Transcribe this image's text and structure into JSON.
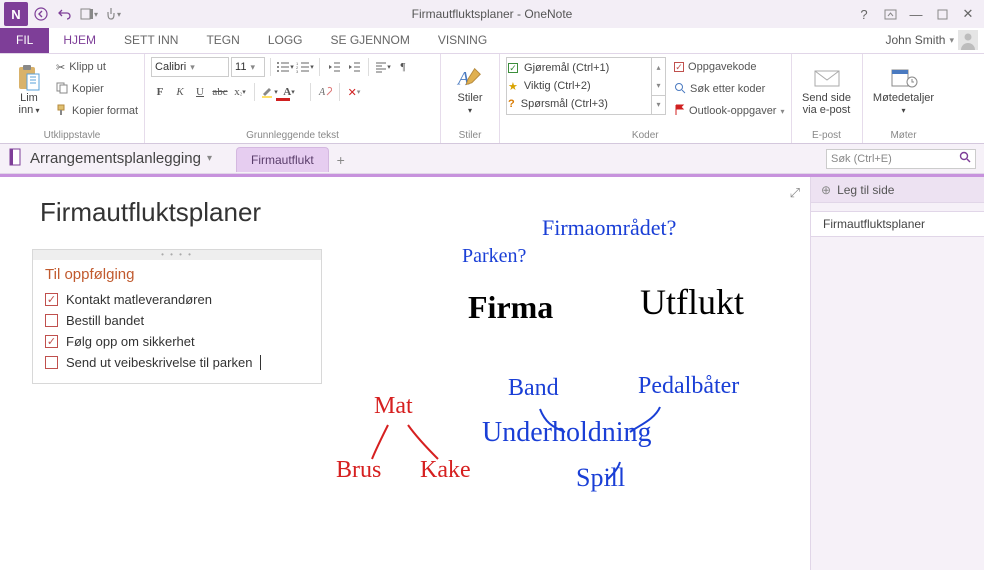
{
  "titlebar": {
    "title": "Firmautfluktsplaner - OneNote"
  },
  "user": {
    "name": "John Smith"
  },
  "file_tab": "FIL",
  "tabs": [
    {
      "label": "HJEM",
      "active": true
    },
    {
      "label": "SETT INN"
    },
    {
      "label": "TEGN"
    },
    {
      "label": "LOGG"
    },
    {
      "label": "SE GJENNOM"
    },
    {
      "label": "VISNING"
    }
  ],
  "ribbon": {
    "clipboard": {
      "paste_label": "Lim\ninn",
      "cut": "Klipp ut",
      "copy": "Kopier",
      "format_painter": "Kopier format",
      "group": "Utklippstavle"
    },
    "font": {
      "name": "Calibri",
      "size": "11",
      "group": "Grunnleggende tekst"
    },
    "styles": {
      "label": "Stiler",
      "group": "Stiler"
    },
    "tags": {
      "items": [
        {
          "icon": "☑",
          "color": "#3b8e3b",
          "label": "Gjøremål (Ctrl+1)"
        },
        {
          "icon": "★",
          "color": "#d9a300",
          "label": "Viktig (Ctrl+2)"
        },
        {
          "icon": "?",
          "color": "#d97a00",
          "label": "Spørsmål (Ctrl+3)"
        }
      ],
      "task_tag": "Oppgavekode",
      "find_tags": "Søk etter koder",
      "outlook_tasks": "Outlook-oppgaver",
      "group": "Koder"
    },
    "email": {
      "label": "Send side\nvia e-post",
      "group": "E-post"
    },
    "meeting": {
      "label": "Møtedetaljer",
      "group": "Møter"
    }
  },
  "notebook": {
    "name": "Arrangementsplanlegging",
    "section": "Firmautflukt",
    "search_placeholder": "Søk (Ctrl+E)"
  },
  "page": {
    "title": "Firmautfluktsplaner",
    "followup_header": "Til oppfølging",
    "todos": [
      {
        "checked": true,
        "text": "Kontakt matleverandøren"
      },
      {
        "checked": false,
        "text": "Bestill bandet"
      },
      {
        "checked": true,
        "text": "Følg opp om sikkerhet"
      },
      {
        "checked": false,
        "text": "Send ut veibeskrivelse til parken"
      }
    ],
    "ink": {
      "firmaomradet": "Firmaområdet?",
      "parken": "Parken?",
      "firma": "Firma",
      "utflukt": "Utflukt",
      "band": "Band",
      "pedalbater": "Pedalbåter",
      "underholdning": "Underholdning",
      "spill": "Spill",
      "mat": "Mat",
      "brus": "Brus",
      "kake": "Kake"
    }
  },
  "sidepane": {
    "add_page": "Leg til side",
    "pages": [
      "Firmautfluktsplaner"
    ]
  }
}
